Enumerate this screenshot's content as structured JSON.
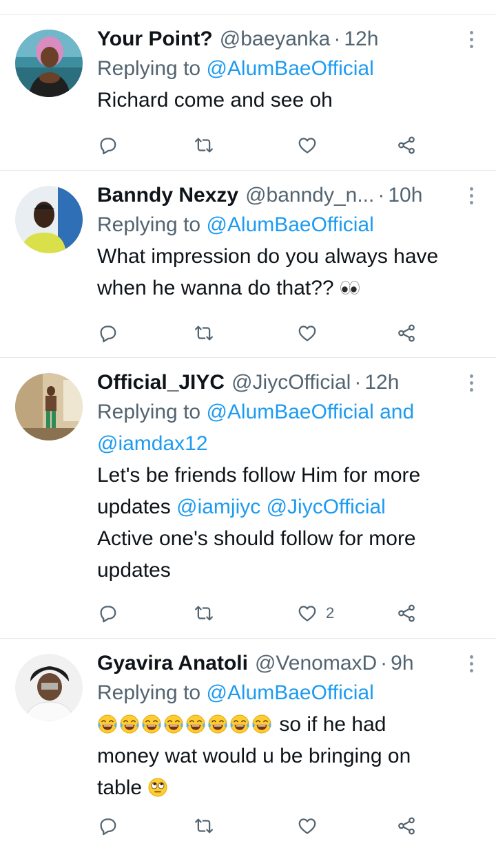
{
  "tweets": [
    {
      "name": "Your Point?",
      "handle": "@baeyanka",
      "sep": "·",
      "time": "12h",
      "replying_prefix": "Replying to",
      "replying_to": "@AlumBaeOfficial",
      "lines": [
        "Richard come and see oh"
      ],
      "like_count": ""
    },
    {
      "name": "Banndy Nexzy",
      "handle": "@banndy_n...",
      "sep": "·",
      "time": "10h",
      "replying_prefix": "Replying to",
      "replying_to": "@AlumBaeOfficial",
      "lines": [
        "What impression do you always have",
        "when he wanna do that??"
      ],
      "like_count": ""
    },
    {
      "name": "Official_JIYC",
      "handle": "@JiycOfficial",
      "sep": "·",
      "time": "12h",
      "replying_prefix": "Replying to",
      "replying_to": "@AlumBaeOfficial and",
      "replying_to_2": "@iamdax12",
      "lines": [
        "Let's be friends follow Him for more",
        "updates",
        "@iamjiyc @JiycOfficial",
        "Active one's should follow for more",
        "updates"
      ],
      "like_count": "2"
    },
    {
      "name": "Gyavira Anatoli",
      "handle": "@VenomaxD",
      "sep": "·",
      "time": "9h",
      "replying_prefix": "Replying to",
      "replying_to": "@AlumBaeOfficial",
      "lines": [
        "so if he had",
        "money wat would u be bringing on",
        "table"
      ],
      "like_count": ""
    }
  ],
  "icons": {
    "reply": "reply-icon",
    "retweet": "retweet-icon",
    "like": "heart-icon",
    "share": "share-icon",
    "more": "more-options-icon"
  },
  "colors": {
    "link": "#1d9bf0",
    "secondary_text": "#536471",
    "divider": "#e1e8ed"
  }
}
